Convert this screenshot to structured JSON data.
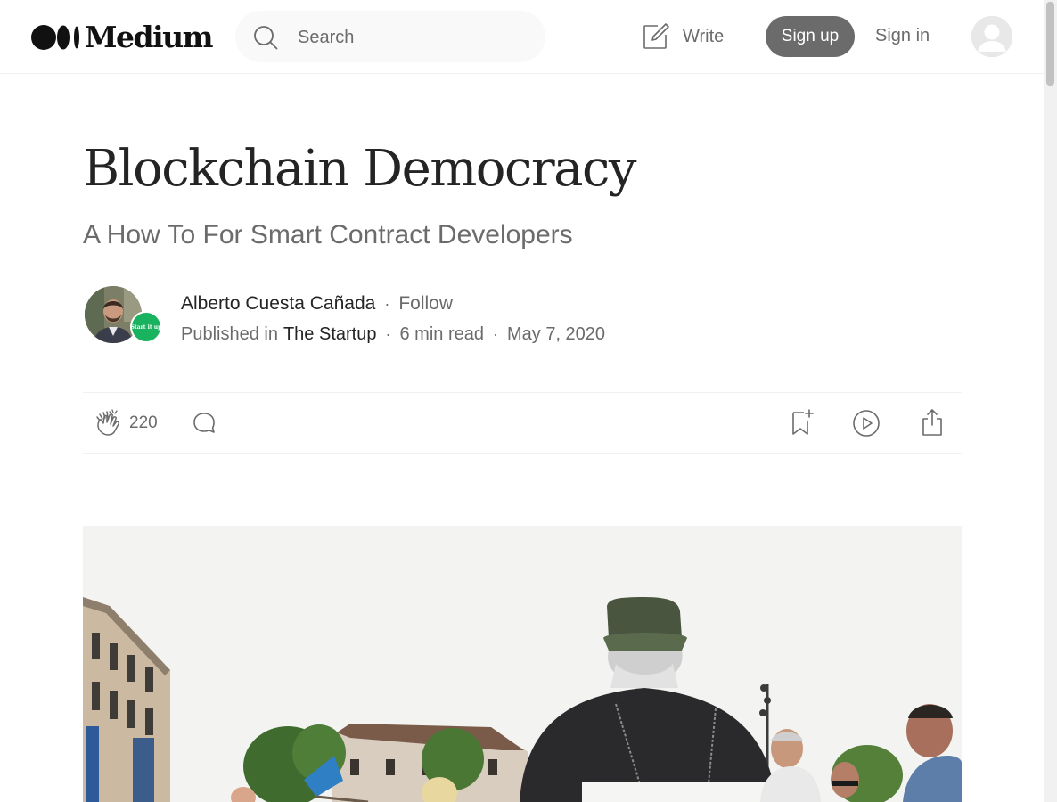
{
  "header": {
    "brand": "Medium",
    "search_placeholder": "Search",
    "write_label": "Write",
    "signup_label": "Sign up",
    "signin_label": "Sign in"
  },
  "article": {
    "title": "Blockchain Democracy",
    "subtitle": "A How To For Smart Contract Developers",
    "author": "Alberto Cuesta Cañada",
    "follow_label": "Follow",
    "published_in_label": "Published in",
    "publication": "The Startup",
    "publication_badge": "Start it up",
    "read_time": "6 min read",
    "date": "May 7, 2020",
    "separator": "·"
  },
  "actions": {
    "clap_count": "220"
  },
  "colors": {
    "text": "#242424",
    "muted": "#6b6b6b",
    "signup_bg": "#6b6b6b",
    "publication_badge_bg": "#19b35f"
  }
}
